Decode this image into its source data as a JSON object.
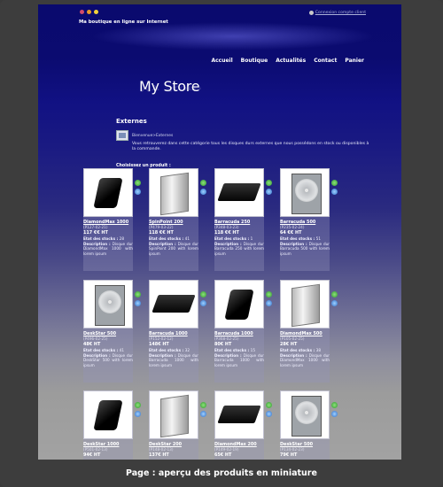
{
  "header": {
    "tagline": "Ma boutique en ligne sur Internet",
    "account_link": "Connexion compte client",
    "flag_colors": [
      "#d24b6a",
      "#e79a2a",
      "#f2d23b"
    ]
  },
  "nav": {
    "items": [
      "Accueil",
      "Boutique",
      "Actualités",
      "Contact",
      "Panier"
    ]
  },
  "logo": {
    "text": "My Store"
  },
  "section": {
    "title": "Externes",
    "breadcrumb": "Bienvenue>Externes",
    "intro": "Vous retrouverez dans cette catégorie tous les disques durs externes que nous possédons en stock ou disponibles à la commande.",
    "choose_label": "Choisissez un produit :"
  },
  "labels": {
    "stock": "Etat des stocks :",
    "description": "Description :"
  },
  "products": [
    {
      "name": "DiamondMax 1000",
      "ref": "(P127-02-21)",
      "price": "117 €€  HT",
      "stock": "28",
      "desc": "Disque dur DiamondMax 1000 with lorem ipsum",
      "shape": "black-ext"
    },
    {
      "name": "SpinPoint 200",
      "ref": "(P479-03-22)",
      "price": "118 €€  HT",
      "stock": "41",
      "desc": "Disque dur SpinPoint 200 with lorem ipsum",
      "shape": "silver-tower"
    },
    {
      "name": "Barracuda 250",
      "ref": "(P348-03-23)",
      "price": "118 €€  HT",
      "stock": "1",
      "desc": "Disque dur Barracuda 250 with lorem ipsum",
      "shape": "black-box"
    },
    {
      "name": "Barracuda 500",
      "ref": "(P235-02-24)",
      "price": "64 €€  HT",
      "stock": "51",
      "desc": "Disque dur Barracuda 500 with lorem ipsum",
      "shape": "bare-disk"
    },
    {
      "name": "DeskStar 500",
      "ref": "(P496-02-25)",
      "price": "48€  HT",
      "stock": "41",
      "desc": "Disque dur DeskStar 500 with lorem ipsum",
      "shape": "bare-disk"
    },
    {
      "name": "Barracuda 1000",
      "ref": "(P152-02-12)",
      "price": "148€  HT",
      "stock": "32",
      "desc": "Disque dur Barracuda 1000 with lorem ipsum",
      "shape": "black-box"
    },
    {
      "name": "Barracuda 1000",
      "ref": "(P368-02-25)",
      "price": "80€  HT",
      "stock": "15",
      "desc": "Disque dur Barracuda 1000 with lorem ipsum",
      "shape": "black-ext"
    },
    {
      "name": "DiamondMax 500",
      "ref": "(P105-02-25)",
      "price": "28€  HT",
      "stock": "38",
      "desc": "Disque dur DiamondMax 1000 with lorem ipsum",
      "shape": "silver-tower"
    },
    {
      "name": "DeskStar 1000",
      "ref": "(P501-02-13)",
      "price": "94€  HT",
      "stock": "",
      "desc": "",
      "shape": "black-ext"
    },
    {
      "name": "DeskStar 200",
      "ref": "(P148-02-13)",
      "price": "137€  HT",
      "stock": "",
      "desc": "",
      "shape": "silver-tower"
    },
    {
      "name": "DiamondMax 200",
      "ref": "(P149-02-19)",
      "price": "65€  HT",
      "stock": "",
      "desc": "",
      "shape": "black-box"
    },
    {
      "name": "DeskStar 500",
      "ref": "(P134-02-23)",
      "price": "79€  HT",
      "stock": "",
      "desc": "",
      "shape": "bare-disk"
    }
  ],
  "caption": "Page : aperçu des produits en miniature"
}
